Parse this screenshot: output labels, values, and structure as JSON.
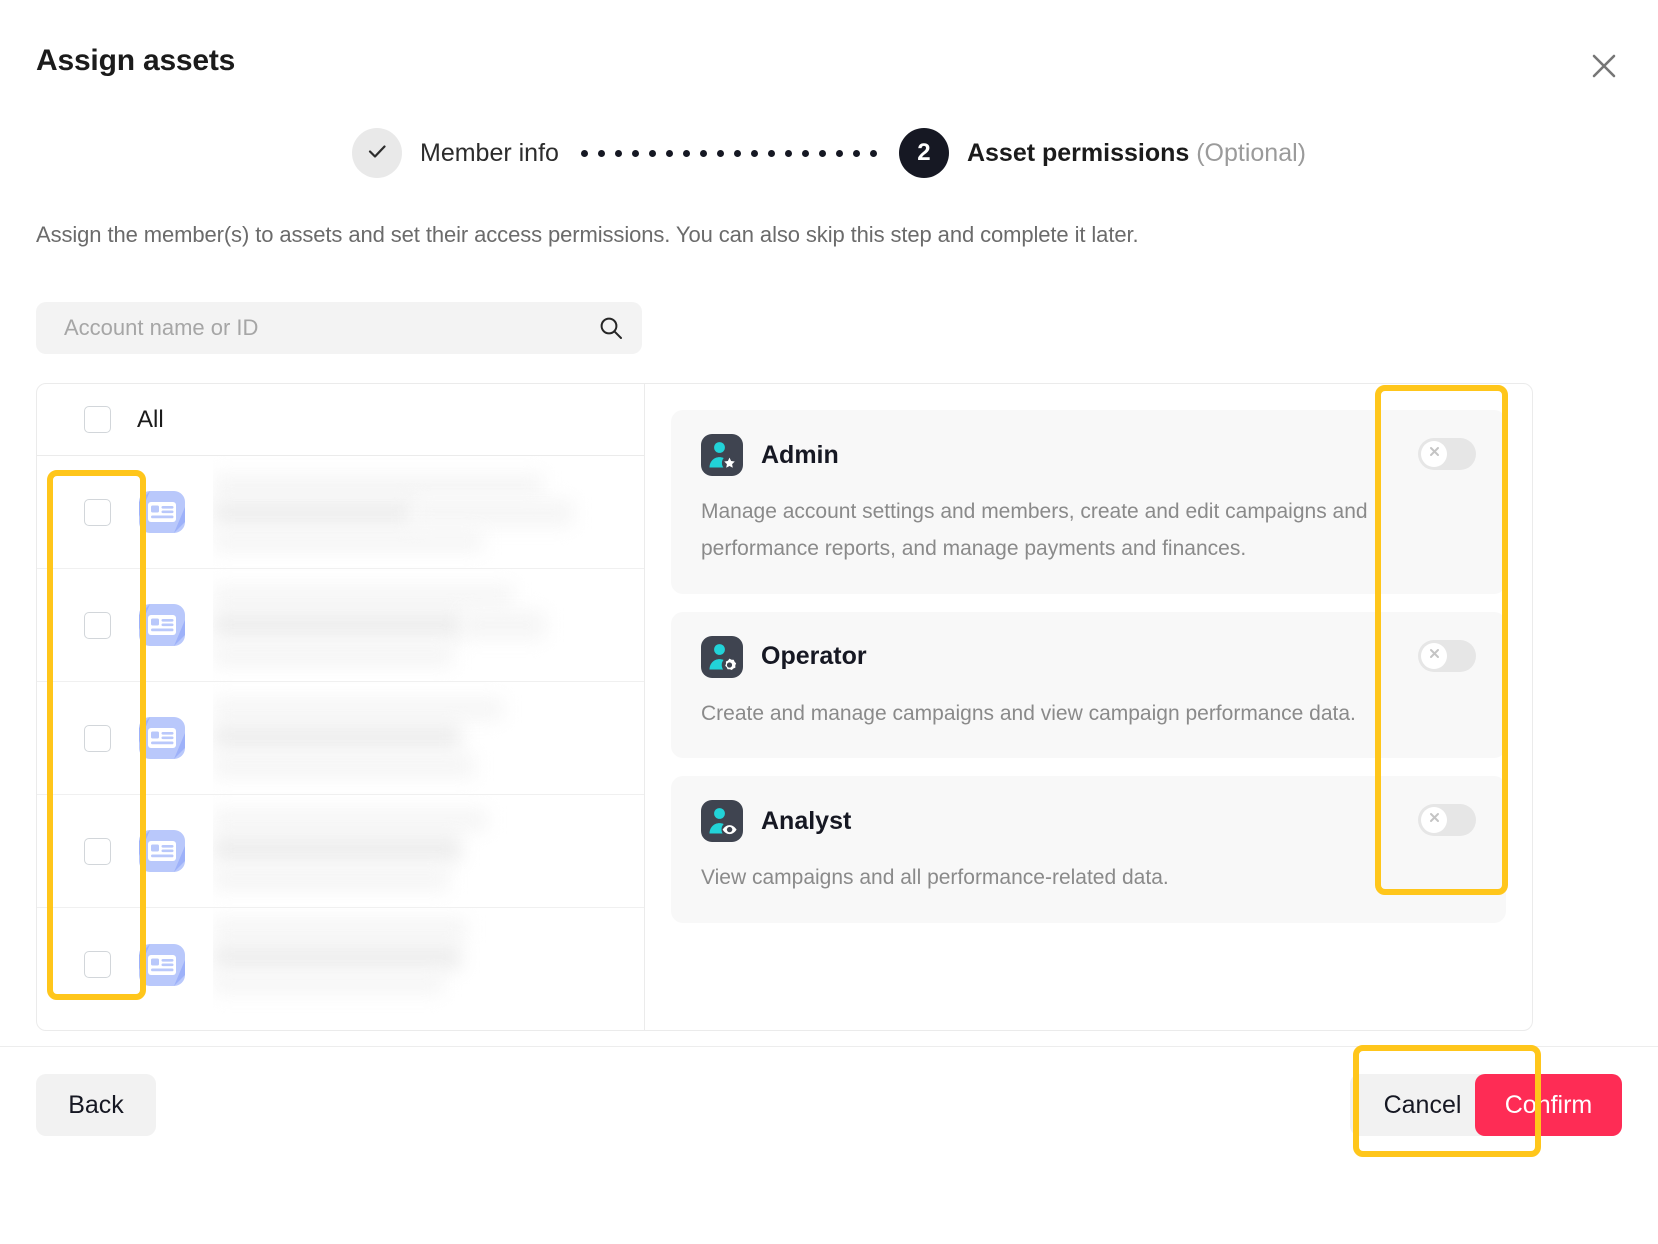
{
  "dialog": {
    "title": "Assign assets",
    "close_icon": "close-icon",
    "description": "Assign the member(s) to assets and set their access permissions. You can also skip this step and complete it later."
  },
  "stepper": {
    "steps": [
      {
        "index": "1",
        "label": "Member info",
        "state": "done",
        "marker": "check-icon"
      },
      {
        "index": "2",
        "label": "Asset permissions",
        "optional": " (Optional)",
        "state": "current",
        "marker": "2"
      }
    ],
    "connector_dots": 18
  },
  "search": {
    "placeholder": "Account name or ID",
    "value": "",
    "icon": "search-icon"
  },
  "accounts_panel": {
    "select_all_label": "All",
    "select_all_checked": false,
    "rows": [
      {
        "icon": "account-card-icon",
        "checked": false,
        "name": "",
        "redacted": true
      },
      {
        "icon": "account-card-icon",
        "checked": false,
        "name": "",
        "redacted": true
      },
      {
        "icon": "account-card-icon",
        "checked": false,
        "name": "",
        "redacted": true
      },
      {
        "icon": "account-card-icon",
        "checked": false,
        "name": "",
        "redacted": true
      },
      {
        "icon": "account-card-icon",
        "checked": false,
        "name": "",
        "redacted": true
      }
    ]
  },
  "permissions": {
    "roles": [
      {
        "name": "Admin",
        "icon": "admin-role-icon",
        "description": "Manage account settings and members, create and edit campaigns and performance reports, and manage payments and finances.",
        "toggle_on": false,
        "toggle_icon": "cross-icon"
      },
      {
        "name": "Operator",
        "icon": "operator-role-icon",
        "description": "Create and manage campaigns and view campaign performance data.",
        "toggle_on": false,
        "toggle_icon": "cross-icon"
      },
      {
        "name": "Analyst",
        "icon": "analyst-role-icon",
        "description": "View campaigns and all performance-related data.",
        "toggle_on": false,
        "toggle_icon": "cross-icon"
      }
    ]
  },
  "footer": {
    "back_label": "Back",
    "cancel_label": "Cancel",
    "confirm_label": "Confirm"
  },
  "colors": {
    "accent_confirm": "#fe2c55",
    "highlight": "#ffc61b",
    "step_current": "#161823",
    "role_icon_bg": "#3f4450",
    "role_icon_fg": "#22d3d8",
    "account_icon_bg": "#8aa4f8"
  }
}
